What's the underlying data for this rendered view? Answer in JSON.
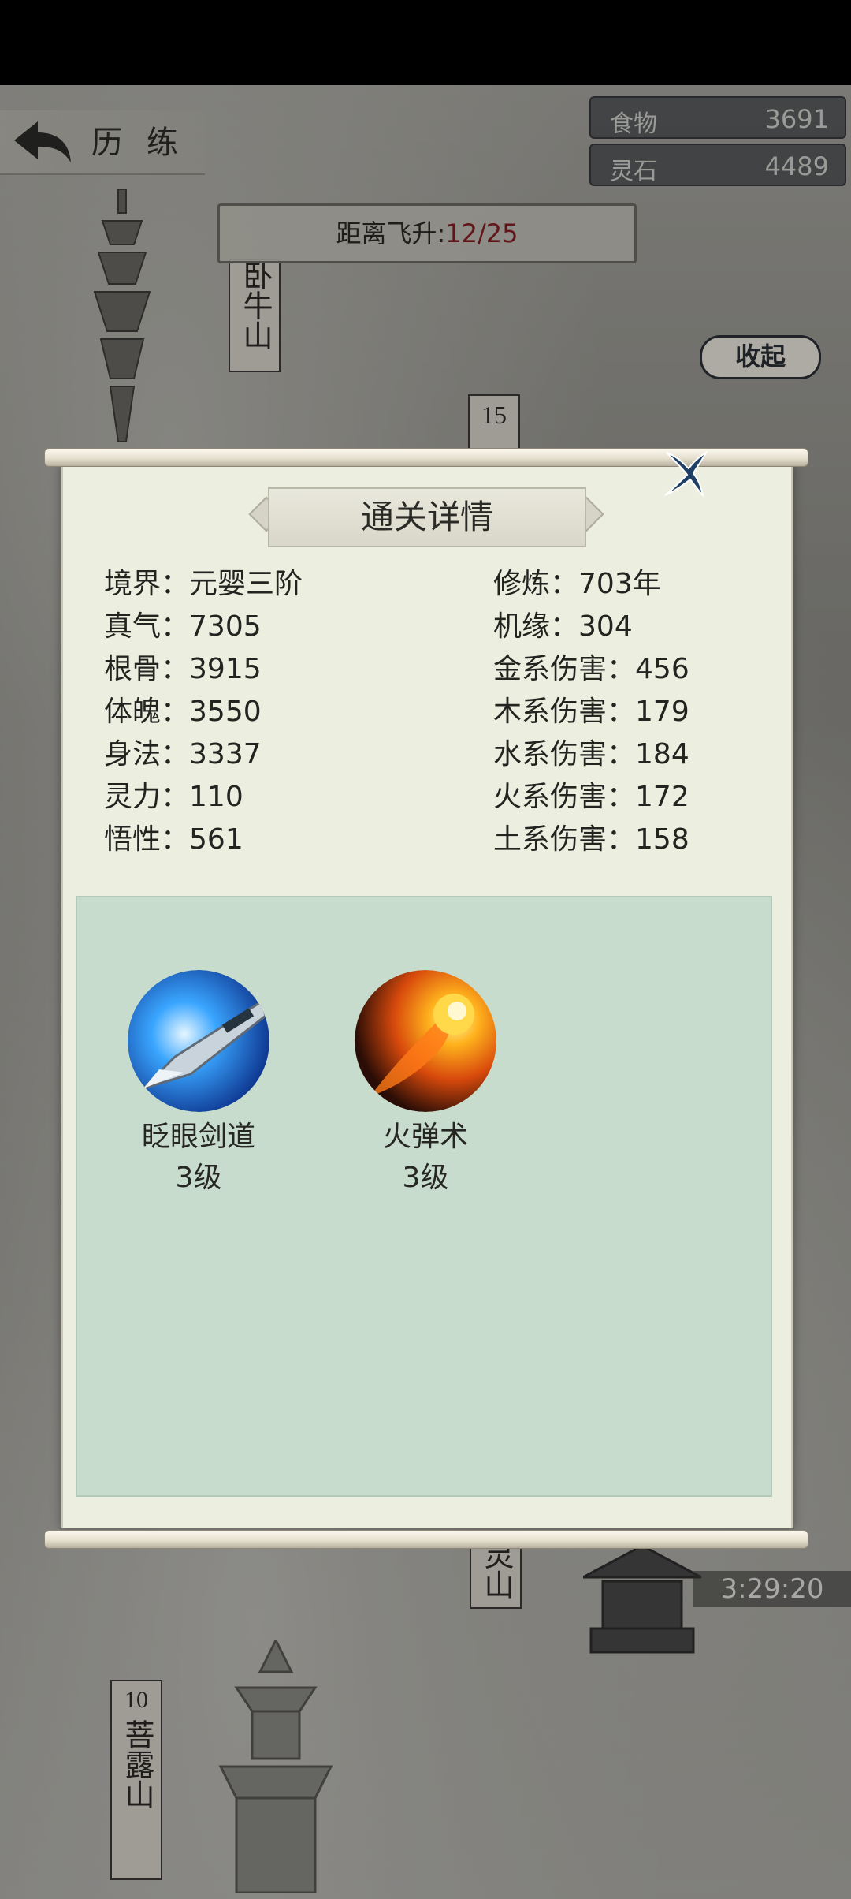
{
  "header": {
    "title": "历 练",
    "resources": [
      {
        "name": "食物",
        "value": "3691"
      },
      {
        "name": "灵石",
        "value": "4489"
      }
    ],
    "ascension": {
      "label": "距离飞升:",
      "value": "12/25"
    }
  },
  "map": {
    "locations": [
      {
        "number": "",
        "name": "卧牛山"
      },
      {
        "number": "15",
        "name": ""
      },
      {
        "number": "",
        "name": "灵山"
      },
      {
        "number": "10",
        "name": "菩露山"
      }
    ],
    "collapse_label": "收起",
    "timer": "3:29:20"
  },
  "dialog": {
    "title": "通关详情",
    "stats_left": [
      {
        "label": "境界：",
        "value": "元婴三阶"
      },
      {
        "label": "真气：",
        "value": "7305"
      },
      {
        "label": "根骨：",
        "value": "3915"
      },
      {
        "label": "体魄：",
        "value": "3550"
      },
      {
        "label": "身法：",
        "value": "3337"
      },
      {
        "label": "灵力：",
        "value": "110"
      },
      {
        "label": "悟性：",
        "value": "561"
      }
    ],
    "stats_right": [
      {
        "label": "修炼：",
        "value": "703年"
      },
      {
        "label": "机缘：",
        "value": "304"
      },
      {
        "label": "金系伤害：",
        "value": "456"
      },
      {
        "label": "木系伤害：",
        "value": "179"
      },
      {
        "label": "水系伤害：",
        "value": "184"
      },
      {
        "label": "火系伤害：",
        "value": "172"
      },
      {
        "label": "土系伤害：",
        "value": "158"
      }
    ],
    "skills": [
      {
        "name": "眨眼剑道",
        "level": "3级",
        "icon": "sword-skill-icon"
      },
      {
        "name": "火弹术",
        "level": "3级",
        "icon": "fireball-skill-icon"
      }
    ]
  }
}
